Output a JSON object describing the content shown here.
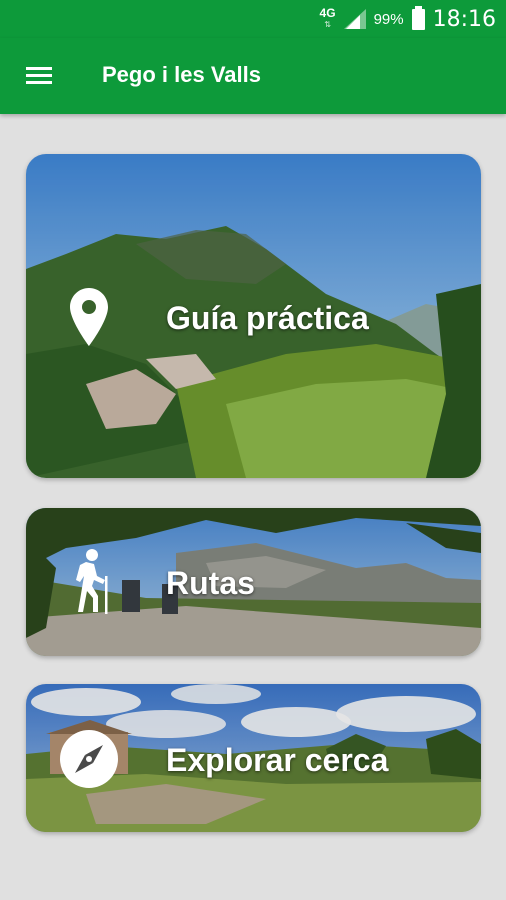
{
  "status_bar": {
    "network": "4G",
    "battery": "99%",
    "time": "18:16"
  },
  "app_bar": {
    "title": "Pego i les Valls",
    "menu_icon": "hamburger-menu-icon"
  },
  "cards": [
    {
      "label": "Guía práctica",
      "icon": "map-pin-icon"
    },
    {
      "label": "Rutas",
      "icon": "hiker-icon"
    },
    {
      "label": "Explorar cerca",
      "icon": "compass-icon"
    }
  ],
  "colors": {
    "primary": "#0d9a3a",
    "background": "#e0e0e0",
    "text_on_primary": "#ffffff"
  }
}
